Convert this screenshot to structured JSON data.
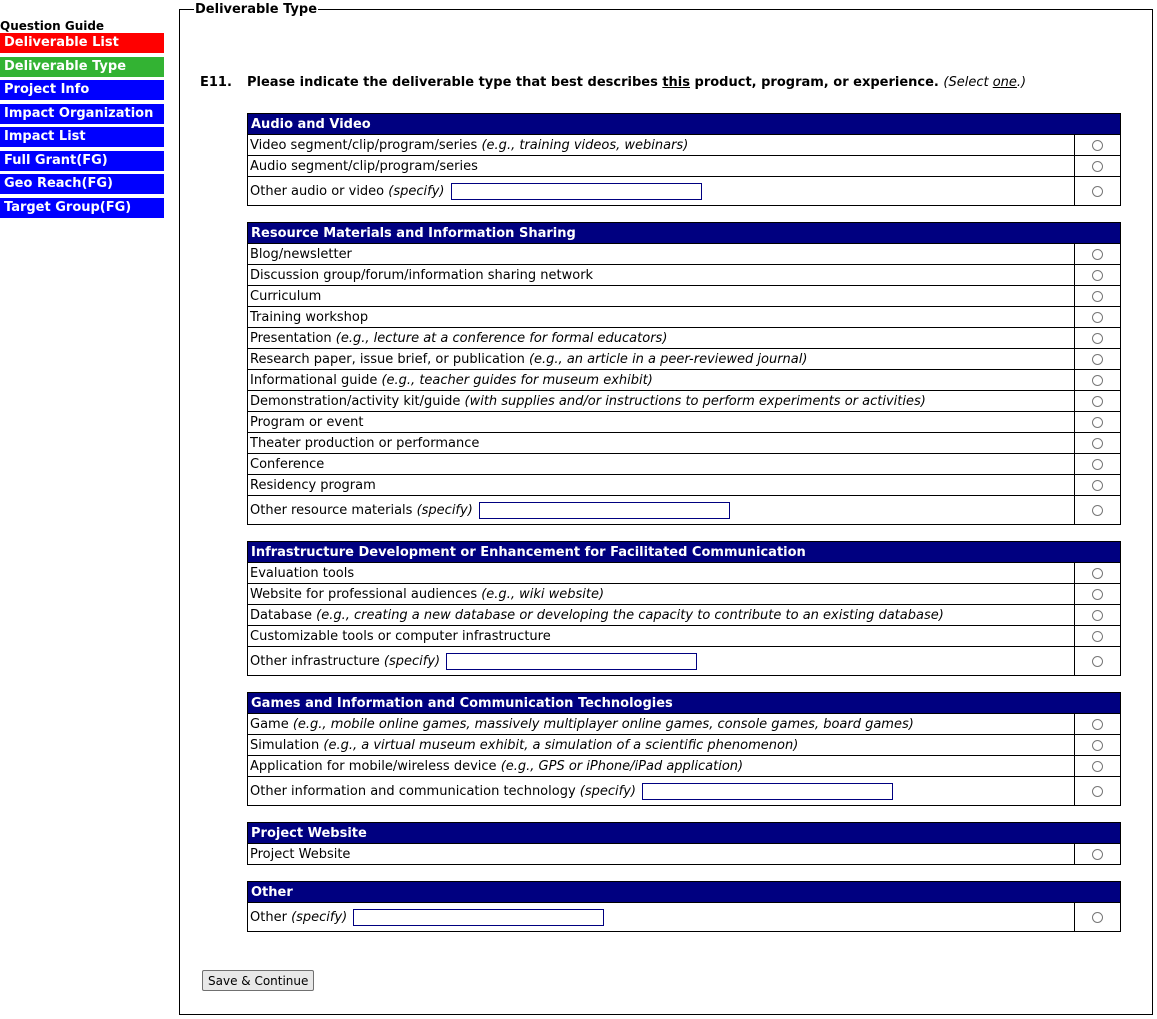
{
  "nav": {
    "title": "Question Guide",
    "items": [
      {
        "label": "Deliverable List",
        "color": "#ff0000"
      },
      {
        "label": "Deliverable Type",
        "color": "#33b333"
      },
      {
        "label": "Project Info",
        "color": "#0000ff"
      },
      {
        "label": "Impact Organization",
        "color": "#0000ff"
      },
      {
        "label": "Impact List",
        "color": "#0000ff"
      },
      {
        "label": "Full Grant(FG)",
        "color": "#0000ff"
      },
      {
        "label": "Geo Reach(FG)",
        "color": "#0000ff"
      },
      {
        "label": "Target Group(FG)",
        "color": "#0000ff"
      }
    ]
  },
  "legend": "Deliverable Type",
  "question": {
    "number": "E11.",
    "text_before": "Please indicate the deliverable type that best describes ",
    "emphasis": "this",
    "text_after": " product, program, or experience.",
    "hint_before": "(Select ",
    "hint_emphasis": "one",
    "hint_after": ".)"
  },
  "sections": [
    {
      "title": "Audio and Video",
      "items": [
        {
          "label": "Video segment/clip/program/series",
          "note": "(e.g., training videos, webinars)"
        },
        {
          "label": "Audio segment/clip/program/series"
        },
        {
          "label": "Other audio or video",
          "note": "(specify)",
          "specify": ""
        }
      ]
    },
    {
      "title": "Resource Materials and Information Sharing",
      "items": [
        {
          "label": "Blog/newsletter"
        },
        {
          "label": "Discussion group/forum/information sharing network"
        },
        {
          "label": "Curriculum"
        },
        {
          "label": "Training workshop"
        },
        {
          "label": "Presentation",
          "note": "(e.g., lecture at a conference for formal educators)"
        },
        {
          "label": "Research paper, issue brief, or publication",
          "note": "(e.g., an article in a peer-reviewed journal)"
        },
        {
          "label": "Informational guide",
          "note": "(e.g., teacher guides for museum exhibit)"
        },
        {
          "label": "Demonstration/activity kit/guide",
          "note": "(with supplies and/or instructions to perform experiments or activities)"
        },
        {
          "label": "Program or event"
        },
        {
          "label": "Theater production or performance"
        },
        {
          "label": "Conference"
        },
        {
          "label": "Residency program"
        },
        {
          "label": "Other resource materials",
          "note": "(specify)",
          "specify": ""
        }
      ]
    },
    {
      "title": "Infrastructure Development or Enhancement for Facilitated Communication",
      "items": [
        {
          "label": "Evaluation tools"
        },
        {
          "label": "Website for professional audiences",
          "note": "(e.g., wiki website)"
        },
        {
          "label": "Database",
          "note": "(e.g., creating a new database or developing the capacity to contribute to an existing database)"
        },
        {
          "label": "Customizable tools or computer infrastructure"
        },
        {
          "label": "Other infrastructure",
          "note": "(specify)",
          "specify": ""
        }
      ]
    },
    {
      "title": "Games and Information and Communication Technologies",
      "items": [
        {
          "label": "Game",
          "note": "(e.g., mobile online games, massively multiplayer online games, console games, board games)"
        },
        {
          "label": "Simulation",
          "note": "(e.g., a virtual museum exhibit, a simulation of a scientific phenomenon)"
        },
        {
          "label": "Application for mobile/wireless device",
          "note": "(e.g., GPS or iPhone/iPad application)"
        },
        {
          "label": "Other information and communication technology",
          "note": "(specify)",
          "specify": ""
        }
      ]
    },
    {
      "title": "Project Website",
      "items": [
        {
          "label": "Project Website"
        }
      ]
    },
    {
      "title": "Other",
      "items": [
        {
          "label": "Other",
          "note": "(specify)",
          "specify": ""
        }
      ]
    }
  ],
  "save_button": "Save & Continue"
}
